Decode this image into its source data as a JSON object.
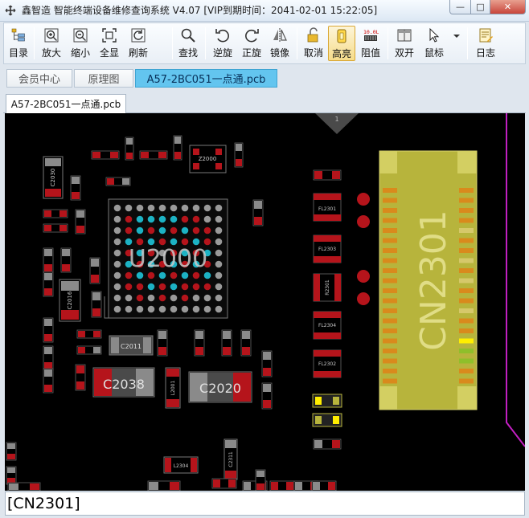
{
  "window": {
    "title": "鑫智造 智能终端设备维修查询系统 V4.07 [VIP到期时间：2041-02-01 15:22:05]",
    "minimize_glyph": "—",
    "maximize_glyph": "□",
    "close_glyph": "✕"
  },
  "toolbar": {
    "items": [
      {
        "label": "目录",
        "icon": "tree-icon"
      },
      {
        "label": "放大",
        "icon": "zoom-in-icon"
      },
      {
        "label": "缩小",
        "icon": "zoom-out-icon"
      },
      {
        "label": "全显",
        "icon": "fit-icon"
      },
      {
        "label": "刷新",
        "icon": "refresh-icon"
      },
      {
        "label": "查找",
        "icon": "search-icon"
      },
      {
        "label": "逆旋",
        "icon": "rotate-ccw-icon"
      },
      {
        "label": "正旋",
        "icon": "rotate-cw-icon"
      },
      {
        "label": "镜像",
        "icon": "mirror-icon"
      },
      {
        "label": "取消",
        "icon": "unlock-icon"
      },
      {
        "label": "高亮",
        "icon": "highlight-icon",
        "active": true
      },
      {
        "label": "阻值",
        "icon": "resistance-icon"
      },
      {
        "label": "双开",
        "icon": "dual-icon"
      },
      {
        "label": "鼠标",
        "icon": "cursor-icon"
      },
      {
        "label": "日志",
        "icon": "log-icon"
      }
    ]
  },
  "tabs": {
    "top": [
      {
        "label": "会员中心",
        "selected": false
      },
      {
        "label": "原理图",
        "selected": false
      },
      {
        "label": "A57-2BC051一点通.pcb",
        "selected": true
      }
    ],
    "document": "A57-2BC051一点通.pcb"
  },
  "pcb": {
    "page_marker": "1",
    "big_labels": {
      "u2000": "U2000",
      "cn2301": "CN2301",
      "c2038": "C2038",
      "c2020": "C2020"
    },
    "small_labels": {
      "z2000": "Z2000",
      "c2030": "C2030",
      "c2016": "C2016",
      "c2011": "C2011",
      "l2001": "L2001",
      "fl2301": "FL2301",
      "fl2303": "FL2303",
      "fl2304": "FL2304",
      "fl2302": "FL2302",
      "r2301": "R2301",
      "l2304": "L2304",
      "c2311": "C2311"
    },
    "colors": {
      "background": "#000000",
      "pad_red": "#b5141b",
      "pad_gray": "#8a8a8a",
      "connector": "#b7b43c",
      "connector_pin": "#d98a1c",
      "highlight_pin": "#ffee00",
      "ball_cyan": "#1cb2c4",
      "ball_red": "#b5141b",
      "ball_gray": "#9a9a9a",
      "trace": "#c21fc2"
    }
  },
  "status": {
    "text": "[CN2301]"
  }
}
